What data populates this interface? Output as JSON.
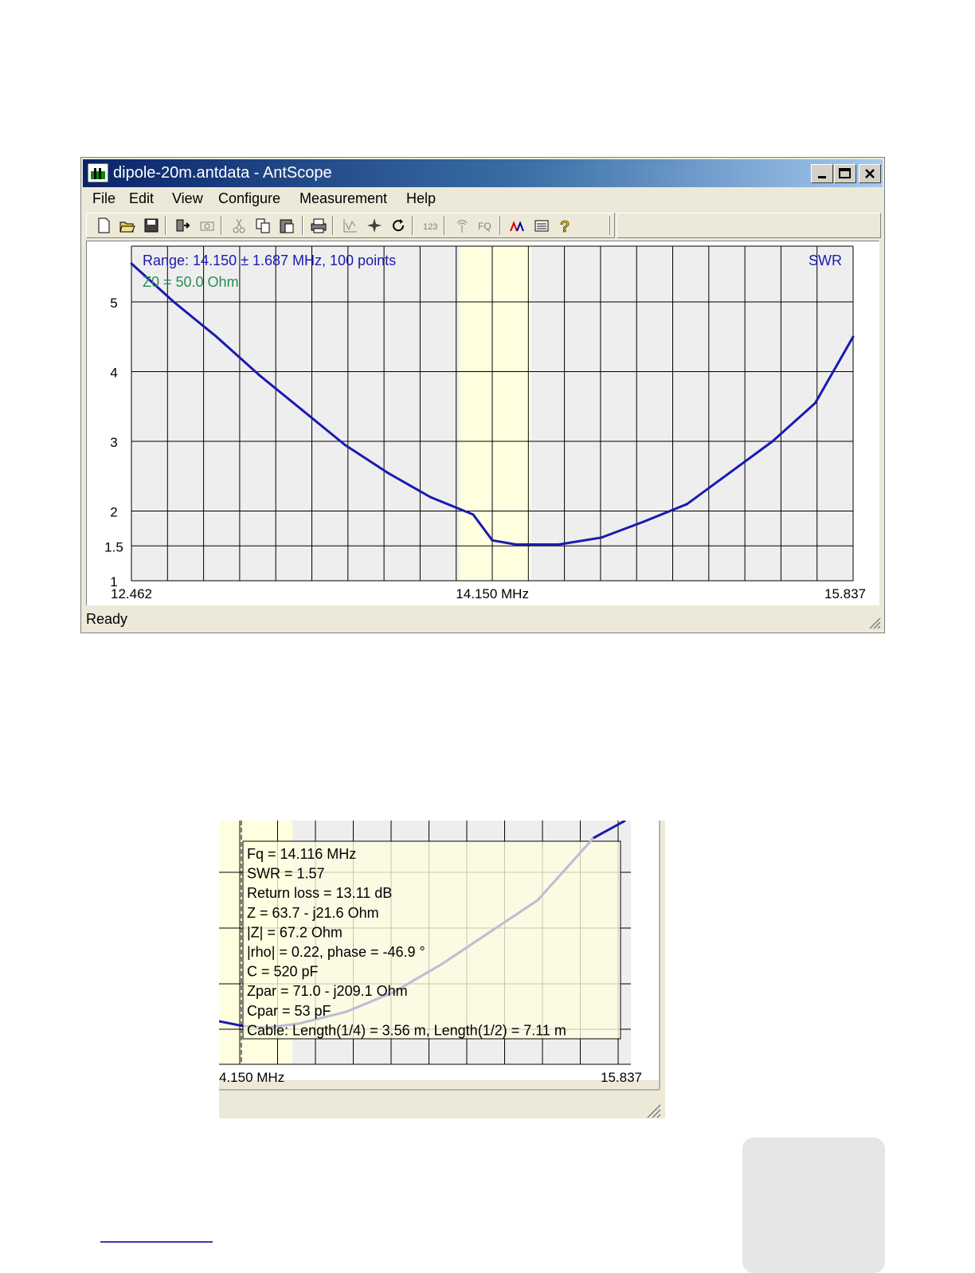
{
  "window": {
    "title": "dipole-20m.antdata - AntScope",
    "menu": [
      "File",
      "Edit",
      "View",
      "Configure",
      "Measurement",
      "Help"
    ],
    "menu_underline": [
      "F",
      "E",
      "V",
      "",
      "",
      "H"
    ],
    "toolbar_icons": [
      "new-file-icon",
      "open-folder-icon",
      "save-icon",
      "export-icon",
      "screenshot-icon",
      "cut-icon",
      "copy-icon",
      "paste-icon",
      "print-icon",
      "chart-icon",
      "marker-icon",
      "refresh-icon",
      "numbers-icon",
      "antenna-icon",
      "fq-icon",
      "graph-icon",
      "list-icon",
      "help-icon"
    ],
    "toolbar_fq_label": "FQ",
    "toolbar_123_label": "123",
    "status": "Ready",
    "colors": {
      "curve": "#1a1ab0",
      "grid": "#000000",
      "band": "#ffffe0",
      "plot_bg": "#eeeeee",
      "title_text": "#1a1ab0",
      "z0_text": "#2e8b57"
    }
  },
  "chart_data": {
    "type": "line",
    "range_label": "Range: 14.150 ± 1.687 MHz, 100 points",
    "z0_label": "Z0 = 50.0 Ohm",
    "series_label": "SWR",
    "x_tick_labels": [
      "12.462",
      "14.150 MHz",
      "15.837"
    ],
    "y_tick_labels": [
      "1",
      "1.5",
      "2",
      "3",
      "4",
      "5"
    ],
    "xlim": [
      12.462,
      15.837
    ],
    "ylim": [
      1,
      5.8
    ],
    "grid": true,
    "band_highlight": [
      13.995,
      14.33
    ],
    "series": [
      {
        "x": [
          12.462,
          12.66,
          12.86,
          13.06,
          13.26,
          13.46,
          13.66,
          13.86,
          14.06,
          14.15,
          14.26,
          14.46,
          14.66,
          14.86,
          15.06,
          15.26,
          15.46,
          15.66,
          15.837
        ],
        "y": [
          5.55,
          5.0,
          4.5,
          3.95,
          3.45,
          2.95,
          2.55,
          2.2,
          1.95,
          1.58,
          1.52,
          1.52,
          1.62,
          1.85,
          2.1,
          2.55,
          3.0,
          3.55,
          4.5
        ]
      }
    ],
    "zoom_axis_labels": [
      "4.150 MHz",
      "15.837"
    ]
  },
  "tooltip": {
    "lines": [
      "Fq = 14.116 MHz",
      "SWR = 1.57",
      "Return loss = 13.11 dB",
      "Z = 63.7 - j21.6 Ohm",
      "|Z| = 67.2 Ohm",
      "|rho| = 0.22, phase = -46.9 °",
      "C = 520 pF",
      "Zpar = 71.0 - j209.1 Ohm",
      "Cpar = 53 pF",
      "Cable: Length(1/4) = 3.56 m, Length(1/2) = 7.11 m"
    ]
  }
}
